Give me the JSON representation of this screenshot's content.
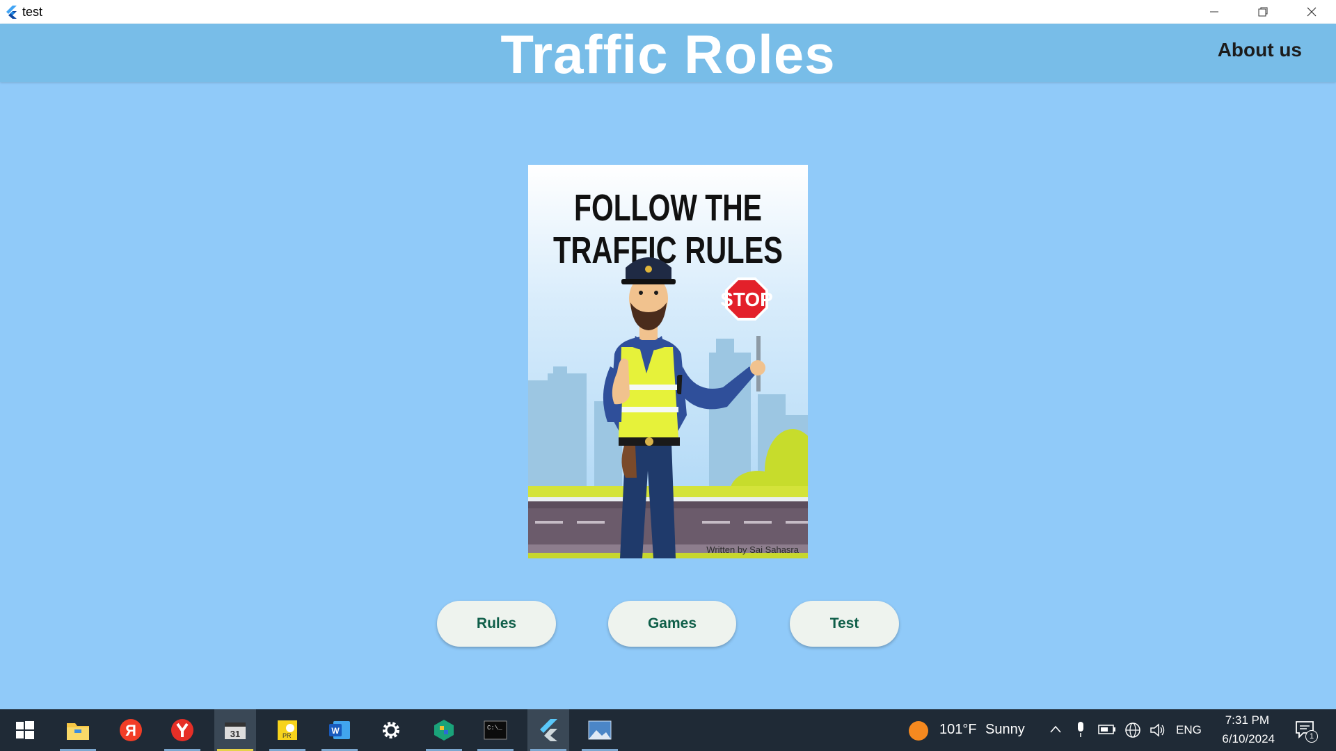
{
  "window": {
    "title": "test",
    "minimize_label": "minimize",
    "maximize_label": "restore",
    "close_label": "close"
  },
  "appbar": {
    "title": "Traffic Roles",
    "about_label": "About us"
  },
  "poster": {
    "headline_line1": "FOLLOW THE",
    "headline_line2": "TRAFFIC RULES",
    "sign_text": "STOP",
    "credit": "Written by Sai Sahasra"
  },
  "buttons": {
    "rules": "Rules",
    "games": "Games",
    "test": "Test"
  },
  "taskbar": {
    "apps": [
      "start-icon",
      "file-explorer-icon",
      "yandex-icon",
      "yandex-browser-icon",
      "video-editor-icon",
      "sticky-notes-icon",
      "word-icon",
      "settings-icon",
      "store-icon",
      "terminal-icon",
      "flutter-icon",
      "photos-icon"
    ],
    "weather_temp": "101°F",
    "weather_text": "Sunny",
    "language": "ENG",
    "time": "7:31 PM",
    "date": "6/10/2024",
    "notification_count": "1"
  },
  "colors": {
    "background": "#90caf9",
    "appbar": "#78bde8",
    "button_bg": "#eef3ee",
    "button_text": "#0e5e48",
    "taskbar": "#1f2a36"
  }
}
